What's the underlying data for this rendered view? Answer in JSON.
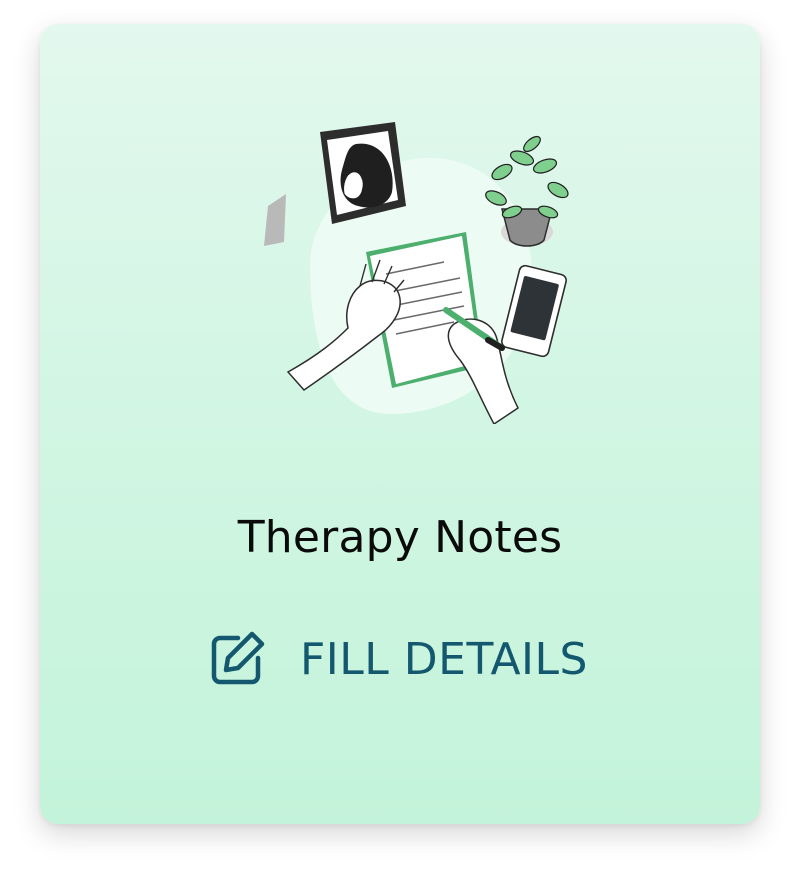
{
  "card": {
    "title": "Therapy Notes",
    "action_label": "FILL DETAILS",
    "action_icon": "edit-icon",
    "illustration": "therapy-notes-illustration"
  },
  "colors": {
    "card_gradient_top": "#e3f8ee",
    "card_gradient_bottom": "#c3f3da",
    "title": "#0b0b0b",
    "action": "#14586f",
    "illustration_accent": "#4caf6e"
  }
}
